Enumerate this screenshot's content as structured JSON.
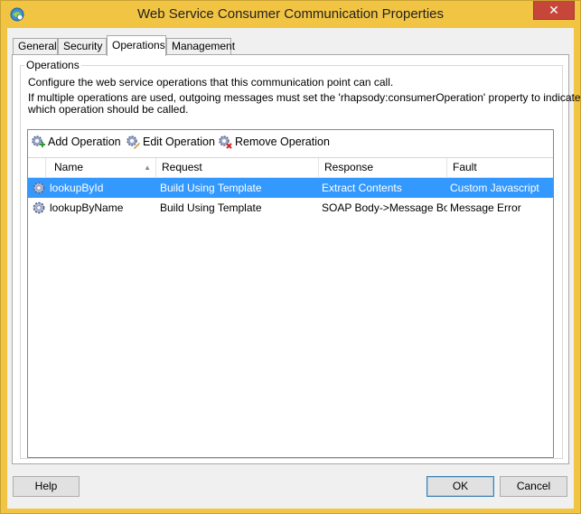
{
  "window": {
    "title": "Web Service Consumer Communication Properties",
    "close_glyph": "✕"
  },
  "tabs": [
    {
      "label": "General",
      "active": false
    },
    {
      "label": "Security",
      "active": false
    },
    {
      "label": "Operations",
      "active": true
    },
    {
      "label": "Management",
      "active": false
    }
  ],
  "operations_group": {
    "label": "Operations",
    "description_line1": "Configure the web service operations that this communication point can call.",
    "description_line2": "If multiple operations are used, outgoing messages must set the 'rhapsody:consumerOperation' property to indicate",
    "description_line3": "which operation should be called."
  },
  "toolbar": {
    "add_label": "Add Operation",
    "edit_label": "Edit Operation",
    "remove_label": "Remove Operation",
    "add_icon": "gear-add-icon",
    "edit_icon": "gear-edit-icon",
    "remove_icon": "gear-remove-icon"
  },
  "table": {
    "columns": [
      "Name",
      "Request",
      "Response",
      "Fault"
    ],
    "sort_indicator": "▲",
    "rows": [
      {
        "name": "lookupById",
        "request": "Build Using Template",
        "response": "Extract Contents",
        "fault": "Custom Javascript",
        "selected": true
      },
      {
        "name": "lookupByName",
        "request": "Build Using Template",
        "response": "SOAP Body->Message Body",
        "fault": "Message Error",
        "selected": false
      }
    ]
  },
  "buttons": {
    "help": "Help",
    "ok": "OK",
    "cancel": "Cancel"
  },
  "colors": {
    "title_bar": "#f2c443",
    "selection": "#3399ff",
    "close_button": "#c7463a"
  }
}
